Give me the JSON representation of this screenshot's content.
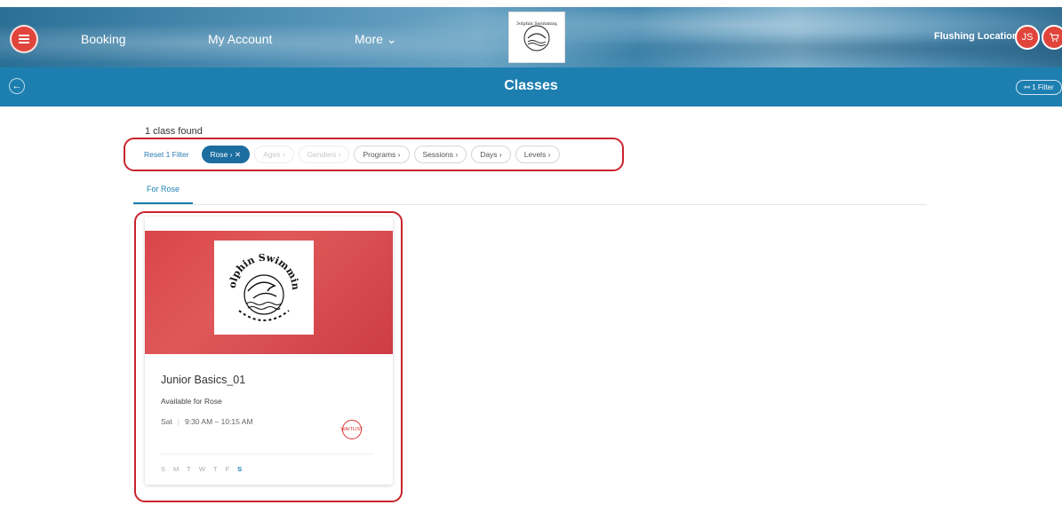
{
  "header": {
    "nav": [
      "Booking",
      "My Account",
      "More ⌄"
    ],
    "location": "Flushing Location",
    "avatar_initials": "JS",
    "cart_icon": "cart-icon",
    "menu_icon": "menu-icon",
    "logo_text": "Dolphin Swimming"
  },
  "subheader": {
    "title": "Classes",
    "filter_label": "⚯ 1 Filter",
    "back_icon": "arrow-left-icon"
  },
  "results": {
    "count_label": "1 class found",
    "reset_label": "Reset 1 Filter",
    "filters": [
      {
        "label": "Rose ›  ✕",
        "state": "active"
      },
      {
        "label": "Ages ›",
        "state": "disabled"
      },
      {
        "label": "Genders ›",
        "state": "disabled"
      },
      {
        "label": "Programs ›",
        "state": "enabled"
      },
      {
        "label": "Sessions ›",
        "state": "enabled"
      },
      {
        "label": "Days ›",
        "state": "enabled"
      },
      {
        "label": "Levels ›",
        "state": "enabled"
      }
    ],
    "tab_label": "For Rose"
  },
  "card": {
    "title": "Junior Basics_01",
    "availability": "Available for Rose",
    "day": "Sat",
    "time": "9:30 AM – 10:15 AM",
    "badge": "WAITLIST",
    "logo_text": "Dolphin Swimming",
    "days": [
      "S",
      "M",
      "T",
      "W",
      "T",
      "F",
      "S"
    ],
    "active_day_index": 6
  },
  "colors": {
    "accent": "#1d7fb0",
    "highlight": "#c9242c",
    "header_red": "#e0443b"
  }
}
